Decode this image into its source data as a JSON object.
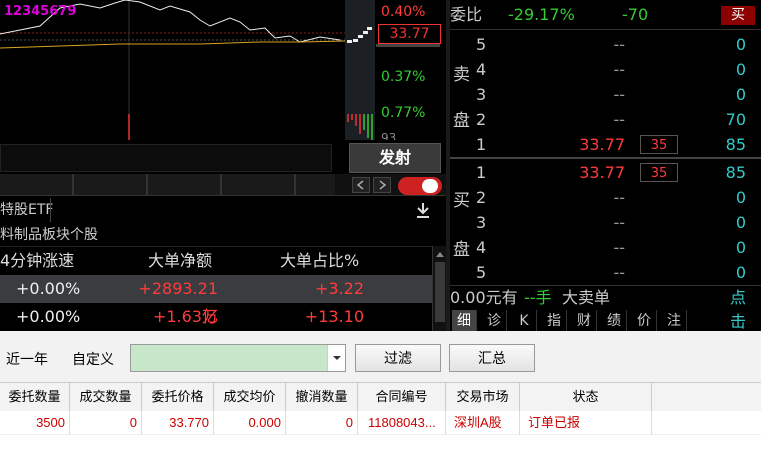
{
  "chart": {
    "legend": "12345679",
    "pct_top": "0.40%",
    "price_tag": "33.77",
    "pct_mid": "0.37%",
    "pct_low": "0.77%",
    "pct_bottom": "93"
  },
  "toolbar": {
    "fire_button": "发射",
    "ticker_partial": "特股ETF",
    "board_title": "料制品板块个股"
  },
  "list": {
    "headers": [
      "4分钟涨速",
      "大单净额",
      "大单占比%"
    ],
    "rows": [
      {
        "speed": "+0.00%",
        "net": "+2893.21万",
        "ratio": "+3.22"
      },
      {
        "speed": "+0.00%",
        "net": "+1.63亿",
        "ratio": "+13.10"
      }
    ]
  },
  "orderbook": {
    "ratio_label": "委比",
    "ratio_pct": "-29.17%",
    "ratio_diff": "-70",
    "buy_btn": "买",
    "sell_chars": [
      "卖",
      "盘"
    ],
    "buy_chars": [
      "买",
      "盘"
    ],
    "sell": [
      {
        "lvl": "5",
        "price": "--",
        "cnt": "",
        "vol": "0"
      },
      {
        "lvl": "4",
        "price": "--",
        "cnt": "",
        "vol": "0"
      },
      {
        "lvl": "3",
        "price": "--",
        "cnt": "",
        "vol": "0"
      },
      {
        "lvl": "2",
        "price": "--",
        "cnt": "",
        "vol": "70"
      },
      {
        "lvl": "1",
        "price": "33.77",
        "cnt": "35",
        "vol": "85"
      }
    ],
    "buy": [
      {
        "lvl": "1",
        "price": "33.77",
        "cnt": "35",
        "vol": "85"
      },
      {
        "lvl": "2",
        "price": "--",
        "cnt": "",
        "vol": "0"
      },
      {
        "lvl": "3",
        "price": "--",
        "cnt": "",
        "vol": "0"
      },
      {
        "lvl": "4",
        "price": "--",
        "cnt": "",
        "vol": "0"
      },
      {
        "lvl": "5",
        "price": "--",
        "cnt": "",
        "vol": "0"
      }
    ],
    "footer_amount": "0.00元有",
    "footer_hands": "--手",
    "footer_label": "大卖单",
    "footer_link": "点击",
    "tabs": [
      "细",
      "诊",
      "K",
      "指",
      "财",
      "绩",
      "价",
      "注"
    ]
  },
  "filter": {
    "period": "近一年",
    "custom": "自定义",
    "combo_value": "",
    "filter_btn": "过滤",
    "summary_btn": "汇总"
  },
  "table": {
    "headers": [
      "委托数量",
      "成交数量",
      "委托价格",
      "成交均价",
      "撤消数量",
      "合同编号",
      "交易市场",
      "状态"
    ],
    "row": [
      "3500",
      "0",
      "33.770",
      "0.000",
      "0",
      "11808043...",
      "深圳A股",
      "订单已报"
    ]
  }
}
